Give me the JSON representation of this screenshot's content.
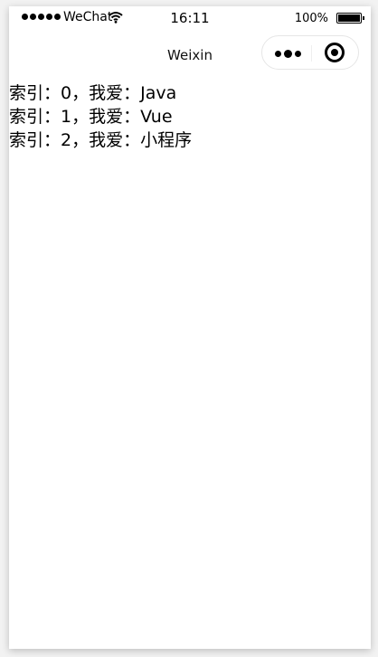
{
  "status_bar": {
    "carrier": "WeChat",
    "time": "16:11",
    "battery": "100%"
  },
  "nav": {
    "title": "Weixin"
  },
  "list": {
    "items": [
      "索引：0，我爱：Java",
      "索引：1，我爱：Vue",
      "索引：2，我爱：小程序"
    ]
  },
  "icons": {
    "signal": "signal-dots-icon",
    "wifi": "wifi-icon",
    "battery": "battery-icon",
    "more": "more-dots-icon",
    "close": "target-close-icon"
  }
}
